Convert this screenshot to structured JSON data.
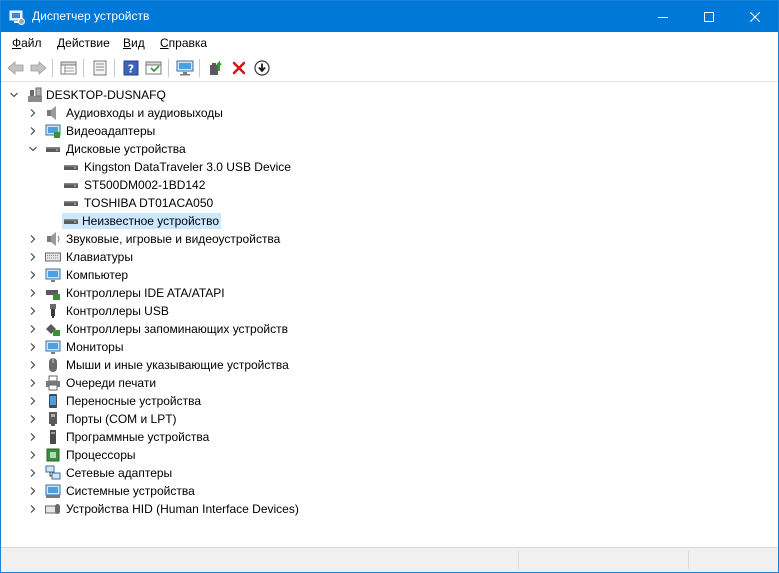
{
  "window": {
    "title": "Диспетчер устройств",
    "accent_color": "#0078d7"
  },
  "menubar": {
    "items": [
      "Файл",
      "Действие",
      "Вид",
      "Справка"
    ]
  },
  "toolbar": {
    "buttons": [
      "back-arrow-icon",
      "forward-arrow-icon",
      "show-hidden-icon",
      "properties-icon",
      "help-icon",
      "view-resources-icon",
      "monitor-scan-icon",
      "update-driver-icon",
      "uninstall-x-icon",
      "disable-device-icon"
    ]
  },
  "tree": {
    "root": "DESKTOP-DUSNAFQ",
    "categories": [
      "Аудиовходы и аудиовыходы",
      "Видеоадаптеры",
      "Дисковые устройства",
      "Звуковые, игровые и видеоустройства",
      "Клавиатуры",
      "Компьютер",
      "Контроллеры IDE ATA/ATAPI",
      "Контроллеры USB",
      "Контроллеры запоминающих устройств",
      "Мониторы",
      "Мыши и иные указывающие устройства",
      "Очереди печати",
      "Переносные устройства",
      "Порты (COM и LPT)",
      "Программные устройства",
      "Процессоры",
      "Сетевые адаптеры",
      "Системные устройства",
      "Устройства HID (Human Interface Devices)"
    ],
    "disk_devices": [
      "Kingston DataTraveler 3.0 USB Device",
      "ST500DM002-1BD142",
      "TOSHIBA DT01ACA050",
      "Неизвестное устройство"
    ],
    "selected_item": "Неизвестное устройство",
    "selection_color": "#cce8ff"
  }
}
